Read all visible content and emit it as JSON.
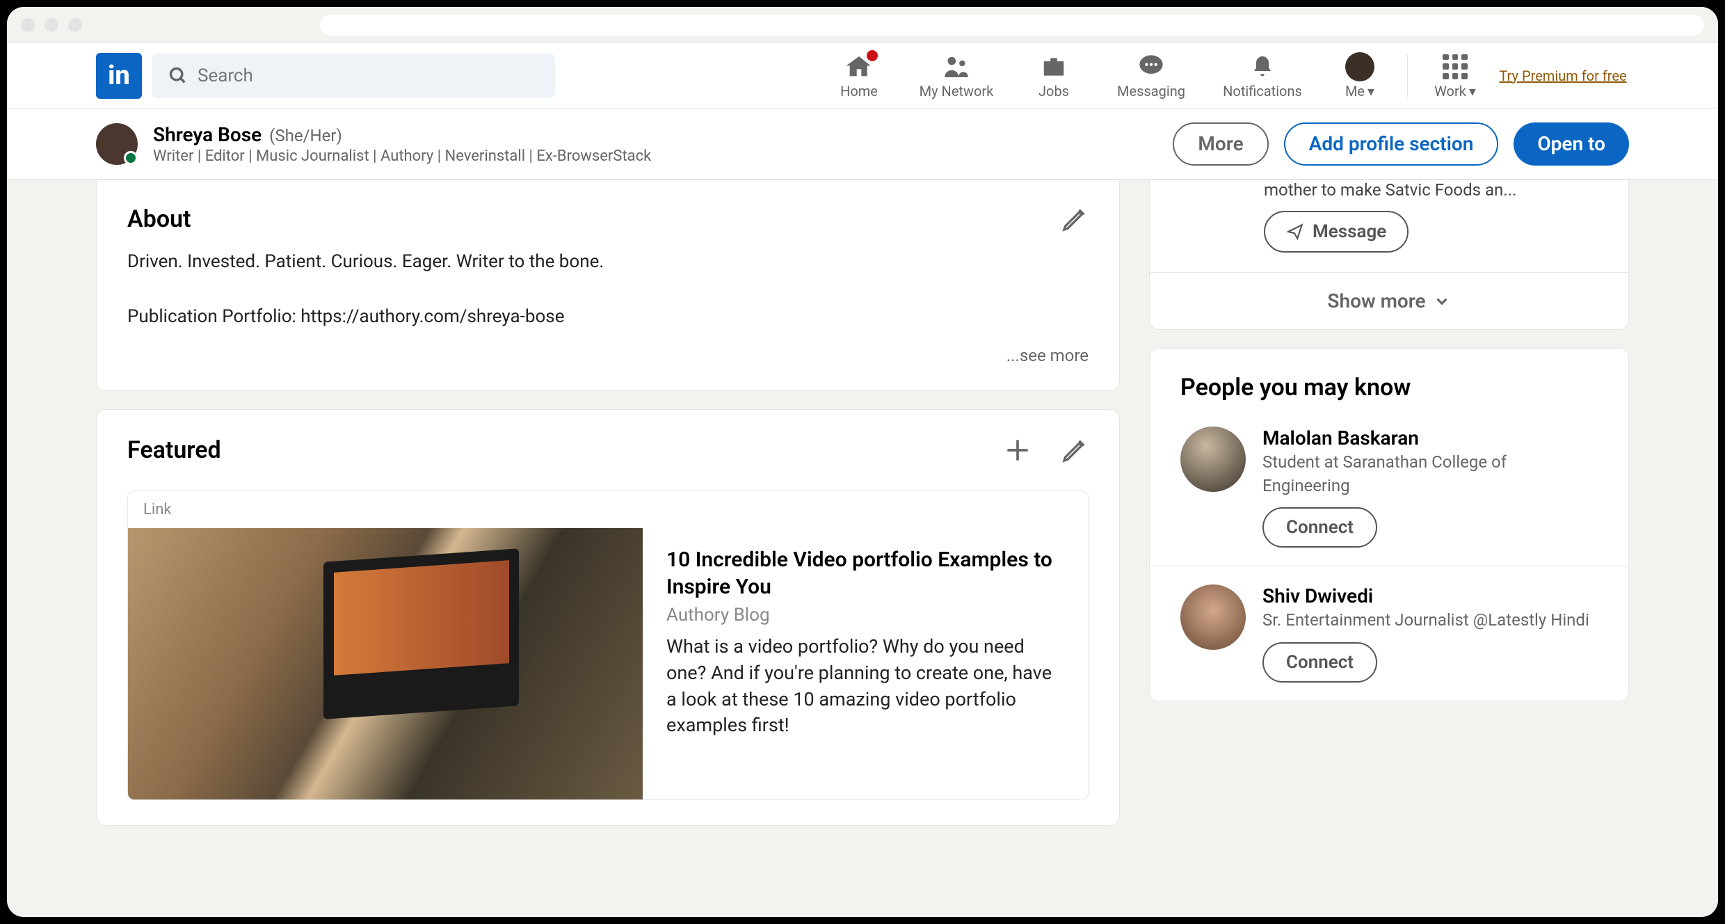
{
  "search": {
    "placeholder": "Search"
  },
  "nav": {
    "home": "Home",
    "network": "My Network",
    "jobs": "Jobs",
    "messaging": "Messaging",
    "notifications": "Notifications",
    "me": "Me",
    "work": "Work",
    "premium": "Try Premium for free"
  },
  "subheader": {
    "name": "Shreya Bose",
    "pronoun": "(She/Her)",
    "subtitle": "Writer | Editor | Music Journalist | Authory | Neverinstall | Ex-BrowserStack",
    "more": "More",
    "add_section": "Add profile section",
    "open_to": "Open to"
  },
  "about": {
    "title": "About",
    "line1": "Driven. Invested. Patient. Curious. Eager. Writer to the bone.",
    "line2": "Publication Portfolio: https://authory.com/shreya-bose",
    "seemore": "...see more"
  },
  "featured": {
    "title": "Featured",
    "badge": "Link",
    "item_title": "10 Incredible Video portfolio Examples to Inspire You",
    "item_source": "Authory Blog",
    "item_desc": "What is a video portfolio? Why do you need one? And if you're planning to create one, have a look at these 10 amazing video portfolio examples first!"
  },
  "side_top": {
    "snippet": "mother to make Satvic Foods an...",
    "message": "Message",
    "showmore": "Show more"
  },
  "pymk": {
    "title": "People you may know",
    "people": [
      {
        "name": "Malolan Baskaran",
        "desc": "Student at Saranathan College of Engineering",
        "cta": "Connect"
      },
      {
        "name": "Shiv Dwivedi",
        "desc": "Sr. Entertainment Journalist @Latestly Hindi",
        "cta": "Connect"
      }
    ]
  }
}
